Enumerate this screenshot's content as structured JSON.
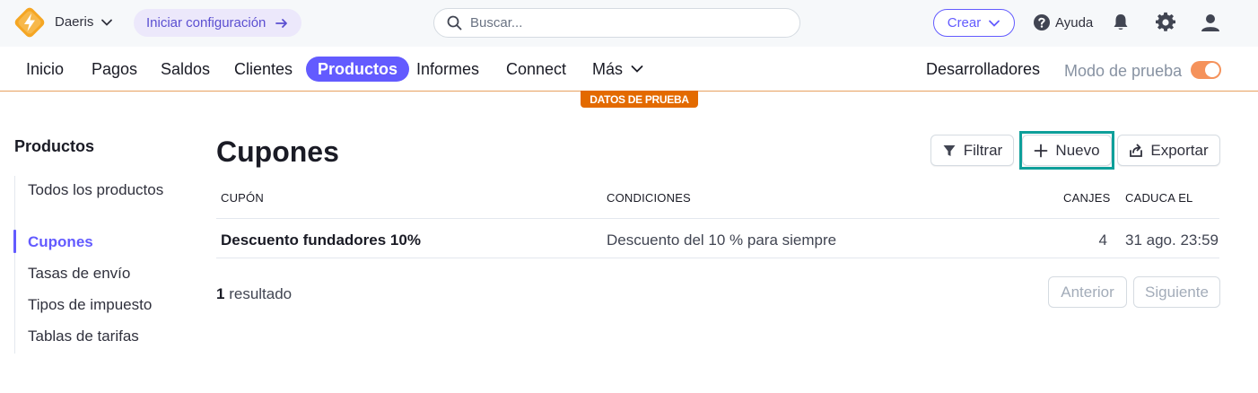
{
  "topbar": {
    "account_name": "Daeris",
    "setup_label": "Iniciar configuración",
    "search_placeholder": "Buscar...",
    "create_label": "Crear",
    "help_label": "Ayuda",
    "icons": [
      "lightning-logo-icon",
      "chevron-down-icon",
      "arrow-right-icon",
      "search-icon",
      "bell-icon",
      "gear-icon",
      "user-icon",
      "help-circle-icon"
    ]
  },
  "nav": {
    "items": [
      "Inicio",
      "Pagos",
      "Saldos",
      "Clientes",
      "Productos",
      "Informes",
      "Connect",
      "Más"
    ],
    "active": "Productos",
    "developers_label": "Desarrolladores",
    "test_mode_label": "Modo de prueba",
    "test_mode_on": true,
    "test_badge": "DATOS DE PRUEBA"
  },
  "sidebar": {
    "title": "Productos",
    "items": [
      "Todos los productos",
      "Cupones",
      "Tasas de envío",
      "Tipos de impuesto",
      "Tablas de tarifas"
    ],
    "active": "Cupones"
  },
  "main": {
    "title": "Cupones",
    "filter_label": "Filtrar",
    "new_label": "Nuevo",
    "export_label": "Exportar",
    "columns": [
      "CUPÓN",
      "CONDICIONES",
      "CANJES",
      "CADUCA EL"
    ],
    "rows": [
      {
        "name": "Descuento fundadores 10%",
        "conditions": "Descuento del 10 % para siempre",
        "redemptions": "4",
        "expires": "31 ago. 23:59"
      }
    ],
    "result_count": "1",
    "result_text": "resultado",
    "prev_label": "Anterior",
    "next_label": "Siguiente"
  },
  "colors": {
    "accent": "#635bff",
    "test_orange": "#e36a00",
    "highlight_teal": "#0e9f9a"
  }
}
